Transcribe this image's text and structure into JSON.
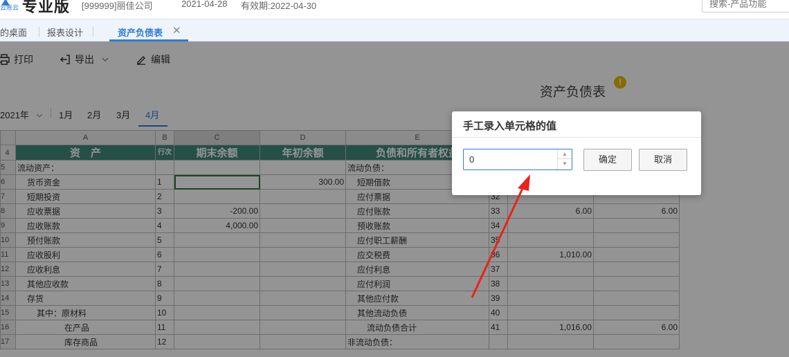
{
  "header": {
    "logo_caption": "云账云",
    "app_title": "专业版",
    "company": "[999999]丽佳公司",
    "date": "2021-04-28",
    "validity": "有效期:2022-04-30",
    "search_placeholder": "搜索-产品功能"
  },
  "tabs": {
    "items": [
      "的桌面",
      "报表设计",
      "资产负债表"
    ],
    "close": "✕"
  },
  "toolbar": {
    "print": "打印",
    "export": "导出",
    "edit": "编辑"
  },
  "report": {
    "title": "资产负债表",
    "warning": "!"
  },
  "period": {
    "year": "2021年",
    "months": [
      "1月",
      "2月",
      "3月",
      "4月"
    ]
  },
  "sheet": {
    "col_letters": [
      "A",
      "B",
      "C",
      "D",
      "E"
    ],
    "header_row_num": "4",
    "headers": {
      "asset": "资　产",
      "line_no": "行次",
      "end_balance": "期末余额",
      "begin_balance": "年初余额",
      "liability": "负债和所有者权益"
    },
    "rows": [
      {
        "rn": "5",
        "a": "流动资产：",
        "b": "",
        "c": "",
        "d": "",
        "e": "流动负债：",
        "f": "",
        "g": "",
        "h": "",
        "ai": 0,
        "ei": 0
      },
      {
        "rn": "6",
        "a": "货币资金",
        "b": "1",
        "c": "",
        "d": "300.00",
        "e": "短期借款",
        "f": "",
        "g": "",
        "h": "",
        "ai": 1,
        "ei": 1
      },
      {
        "rn": "7",
        "a": "短期投资",
        "b": "2",
        "c": "",
        "d": "",
        "e": "应付票据",
        "f": "32",
        "g": "",
        "h": "",
        "ai": 1,
        "ei": 1
      },
      {
        "rn": "8",
        "a": "应收票据",
        "b": "3",
        "c": "-200.00",
        "d": "",
        "e": "应付账款",
        "f": "33",
        "g": "6.00",
        "h": "6.00",
        "ai": 1,
        "ei": 1
      },
      {
        "rn": "9",
        "a": "应收账款",
        "b": "4",
        "c": "4,000.00",
        "d": "",
        "e": "预收账款",
        "f": "34",
        "g": "",
        "h": "",
        "ai": 1,
        "ei": 1
      },
      {
        "rn": "10",
        "a": "预付账款",
        "b": "5",
        "c": "",
        "d": "",
        "e": "应付职工薪酬",
        "f": "35",
        "g": "",
        "h": "",
        "ai": 1,
        "ei": 1
      },
      {
        "rn": "11",
        "a": "应收股利",
        "b": "6",
        "c": "",
        "d": "",
        "e": "应交税费",
        "f": "36",
        "g": "1,010.00",
        "h": "",
        "ai": 1,
        "ei": 1
      },
      {
        "rn": "12",
        "a": "应收利息",
        "b": "7",
        "c": "",
        "d": "",
        "e": "应付利息",
        "f": "37",
        "g": "",
        "h": "",
        "ai": 1,
        "ei": 1
      },
      {
        "rn": "13",
        "a": "其他应收款",
        "b": "8",
        "c": "",
        "d": "",
        "e": "应付利润",
        "f": "38",
        "g": "",
        "h": "",
        "ai": 1,
        "ei": 1
      },
      {
        "rn": "14",
        "a": "存货",
        "b": "9",
        "c": "",
        "d": "",
        "e": "其他应付款",
        "f": "39",
        "g": "",
        "h": "",
        "ai": 1,
        "ei": 1
      },
      {
        "rn": "15",
        "a": "其中：原材料",
        "b": "10",
        "c": "",
        "d": "",
        "e": "其他流动负债",
        "f": "40",
        "g": "",
        "h": "",
        "ai": 2,
        "ei": 1
      },
      {
        "rn": "16",
        "a": "在产品",
        "b": "11",
        "c": "",
        "d": "",
        "e": "流动负债合计",
        "f": "41",
        "g": "1,016.00",
        "h": "6.00",
        "ai": 3,
        "ei": 2
      },
      {
        "rn": "17",
        "a": "库存商品",
        "b": "12",
        "c": "",
        "d": "",
        "e": "非流动负债：",
        "f": "",
        "g": "",
        "h": "",
        "ai": 3,
        "ei": 0
      }
    ]
  },
  "dialog": {
    "title": "手工录入单元格的值",
    "value": "0",
    "ok": "确定",
    "cancel": "取消"
  },
  "colors": {
    "accent": "#2f7ad6",
    "header_fill": "#3f8a7d",
    "arrow": "#e8231b"
  }
}
